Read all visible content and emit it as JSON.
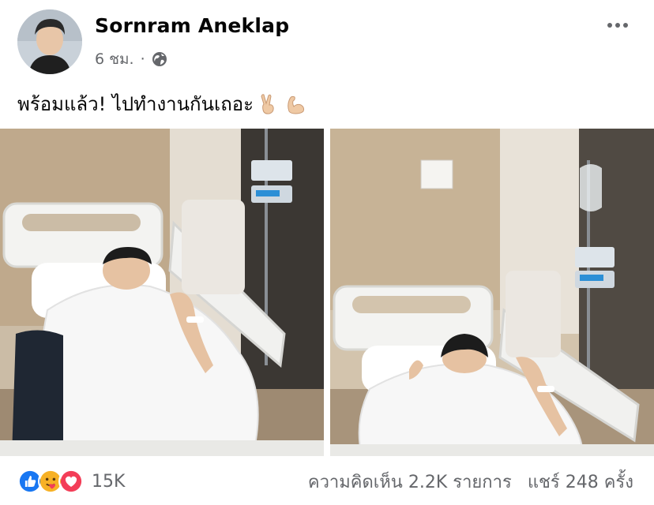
{
  "post": {
    "author": "Sornram Aneklap",
    "time": "6 ชม.",
    "separator": "·",
    "privacy_icon": "globe-icon",
    "caption": "พร้อมแล้ว! ไปทำงานกันเถอะ",
    "caption_emojis": [
      "victory-hand-emoji",
      "flexed-biceps-emoji"
    ]
  },
  "photos": [
    {
      "name": "hospital-photo-1"
    },
    {
      "name": "hospital-photo-2"
    }
  ],
  "engagement": {
    "reaction_icons": [
      "like-icon",
      "care-icon",
      "love-icon"
    ],
    "reaction_count": "15K",
    "comments": "ความคิดเห็น 2.2K รายการ",
    "shares": "แชร์ 248 ครั้ง"
  },
  "colors": {
    "like": "#1877f2",
    "love": "#f33e58",
    "care": "#f7b125",
    "muted": "#65676b"
  }
}
